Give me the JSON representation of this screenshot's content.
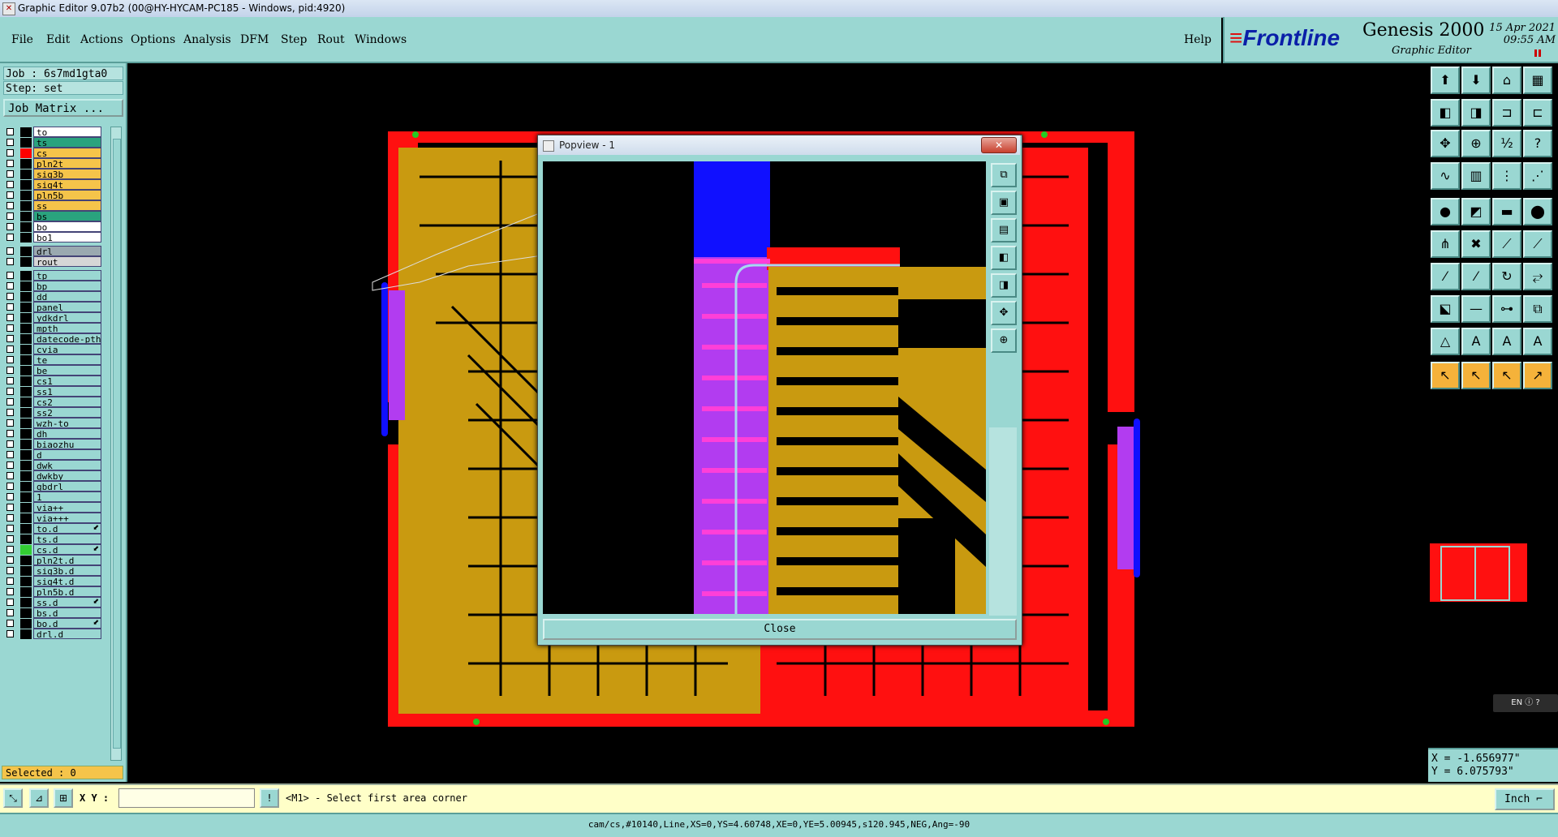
{
  "window": {
    "title": "Graphic Editor 9.07b2 (00@HY-HYCAM-PC185 - Windows, pid:4920)"
  },
  "menu": [
    "File",
    "Edit",
    "Actions",
    "Options",
    "Analysis",
    "DFM",
    "Step",
    "Rout",
    "Windows"
  ],
  "help_label": "Help",
  "brand": {
    "logo_text": "Frontline",
    "product": "Genesis 2000",
    "subtitle": "Graphic Editor",
    "date": "15 Apr 2021",
    "time": "09:55 AM"
  },
  "job": {
    "job_line": "Job : 6s7md1gta0",
    "step_line": "Step: set",
    "matrix_button": "Job Matrix ..."
  },
  "layers": [
    {
      "name": "to",
      "color": "#ffffff",
      "swatch": "#000000"
    },
    {
      "name": "ts",
      "color": "#2aa37e",
      "swatch": "#000000"
    },
    {
      "name": "cs",
      "color": "#f5c44a",
      "swatch": "#ff0000"
    },
    {
      "name": "pln2t",
      "color": "#f5c44a",
      "swatch": "#000000"
    },
    {
      "name": "sig3b",
      "color": "#f5c44a",
      "swatch": "#000000"
    },
    {
      "name": "sig4t",
      "color": "#f5c44a",
      "swatch": "#000000"
    },
    {
      "name": "pln5b",
      "color": "#f5c44a",
      "swatch": "#000000"
    },
    {
      "name": "ss",
      "color": "#f5c44a",
      "swatch": "#000000"
    },
    {
      "name": "bs",
      "color": "#2aa37e",
      "swatch": "#000000"
    },
    {
      "name": "bo",
      "color": "#ffffff",
      "swatch": "#000000"
    },
    {
      "name": "bo1",
      "color": "#ffffff",
      "swatch": "#000000"
    },
    {
      "name": "drl",
      "color": "#9aa9b0",
      "swatch": "#000000",
      "gap": true
    },
    {
      "name": "rout",
      "color": "#d6d6d6",
      "swatch": "#000000"
    },
    {
      "name": "tp",
      "color": "#9ad7d2",
      "swatch": "#000000",
      "gap": true
    },
    {
      "name": "bp",
      "color": "#9ad7d2",
      "swatch": "#000000"
    },
    {
      "name": "dd",
      "color": "#9ad7d2",
      "swatch": "#000000"
    },
    {
      "name": "panel",
      "color": "#9ad7d2",
      "swatch": "#000000"
    },
    {
      "name": "ydkdrl",
      "color": "#9ad7d2",
      "swatch": "#000000"
    },
    {
      "name": "mpth",
      "color": "#9ad7d2",
      "swatch": "#000000"
    },
    {
      "name": "datecode-pth",
      "color": "#9ad7d2",
      "swatch": "#000000"
    },
    {
      "name": "cvia",
      "color": "#9ad7d2",
      "swatch": "#000000"
    },
    {
      "name": "te",
      "color": "#9ad7d2",
      "swatch": "#000000"
    },
    {
      "name": "be",
      "color": "#9ad7d2",
      "swatch": "#000000"
    },
    {
      "name": "cs1",
      "color": "#9ad7d2",
      "swatch": "#000000"
    },
    {
      "name": "ss1",
      "color": "#9ad7d2",
      "swatch": "#000000"
    },
    {
      "name": "cs2",
      "color": "#9ad7d2",
      "swatch": "#000000"
    },
    {
      "name": "ss2",
      "color": "#9ad7d2",
      "swatch": "#000000"
    },
    {
      "name": "wzh-to",
      "color": "#9ad7d2",
      "swatch": "#000000"
    },
    {
      "name": "dh",
      "color": "#9ad7d2",
      "swatch": "#000000"
    },
    {
      "name": "biaozhu",
      "color": "#9ad7d2",
      "swatch": "#000000"
    },
    {
      "name": "d",
      "color": "#9ad7d2",
      "swatch": "#000000"
    },
    {
      "name": "dwk",
      "color": "#9ad7d2",
      "swatch": "#000000"
    },
    {
      "name": "dwkby",
      "color": "#9ad7d2",
      "swatch": "#000000"
    },
    {
      "name": "gbdrl",
      "color": "#9ad7d2",
      "swatch": "#000000"
    },
    {
      "name": "1",
      "color": "#9ad7d2",
      "swatch": "#000000"
    },
    {
      "name": "via++",
      "color": "#9ad7d2",
      "swatch": "#000000"
    },
    {
      "name": "via+++",
      "color": "#9ad7d2",
      "swatch": "#000000"
    },
    {
      "name": "to.d",
      "color": "#9ad7d2",
      "swatch": "#000000",
      "arrow": true
    },
    {
      "name": "ts.d",
      "color": "#9ad7d2",
      "swatch": "#000000"
    },
    {
      "name": "cs.d",
      "color": "#9ad7d2",
      "swatch": "#33cc33",
      "arrow": true
    },
    {
      "name": "pln2t.d",
      "color": "#9ad7d2",
      "swatch": "#000000"
    },
    {
      "name": "sig3b.d",
      "color": "#9ad7d2",
      "swatch": "#000000"
    },
    {
      "name": "sig4t.d",
      "color": "#9ad7d2",
      "swatch": "#000000"
    },
    {
      "name": "pln5b.d",
      "color": "#9ad7d2",
      "swatch": "#000000"
    },
    {
      "name": "ss.d",
      "color": "#9ad7d2",
      "swatch": "#000000",
      "arrow": true
    },
    {
      "name": "bs.d",
      "color": "#9ad7d2",
      "swatch": "#000000"
    },
    {
      "name": "bo.d",
      "color": "#9ad7d2",
      "swatch": "#000000",
      "arrow": true
    },
    {
      "name": "drl.d",
      "color": "#9ad7d2",
      "swatch": "#000000"
    }
  ],
  "selected_text": "Selected : 0",
  "popview": {
    "title": "Popview - 1",
    "close_button": "Close"
  },
  "coords": {
    "x_line": "X = -1.656977\"",
    "y_line": "Y = 6.075793\""
  },
  "lang_indicator": "EN",
  "bottom": {
    "xy_label": "X Y :",
    "xy_value": "",
    "prompt": "<M1> - Select first area corner",
    "unit": "Inch"
  },
  "status_line": "cam/cs,#10140,Line,XS=0,YS=4.60748,XE=0,YE=5.00945,s120.945,NEG,Ang=-90",
  "colors": {
    "panel": "#9ad7d2",
    "copper_top": "#c99a10",
    "copper_bottom": "#ff1010",
    "mask": "#b23cf0",
    "pad": "#ff3fd8",
    "fill_blue": "#1010ff"
  }
}
